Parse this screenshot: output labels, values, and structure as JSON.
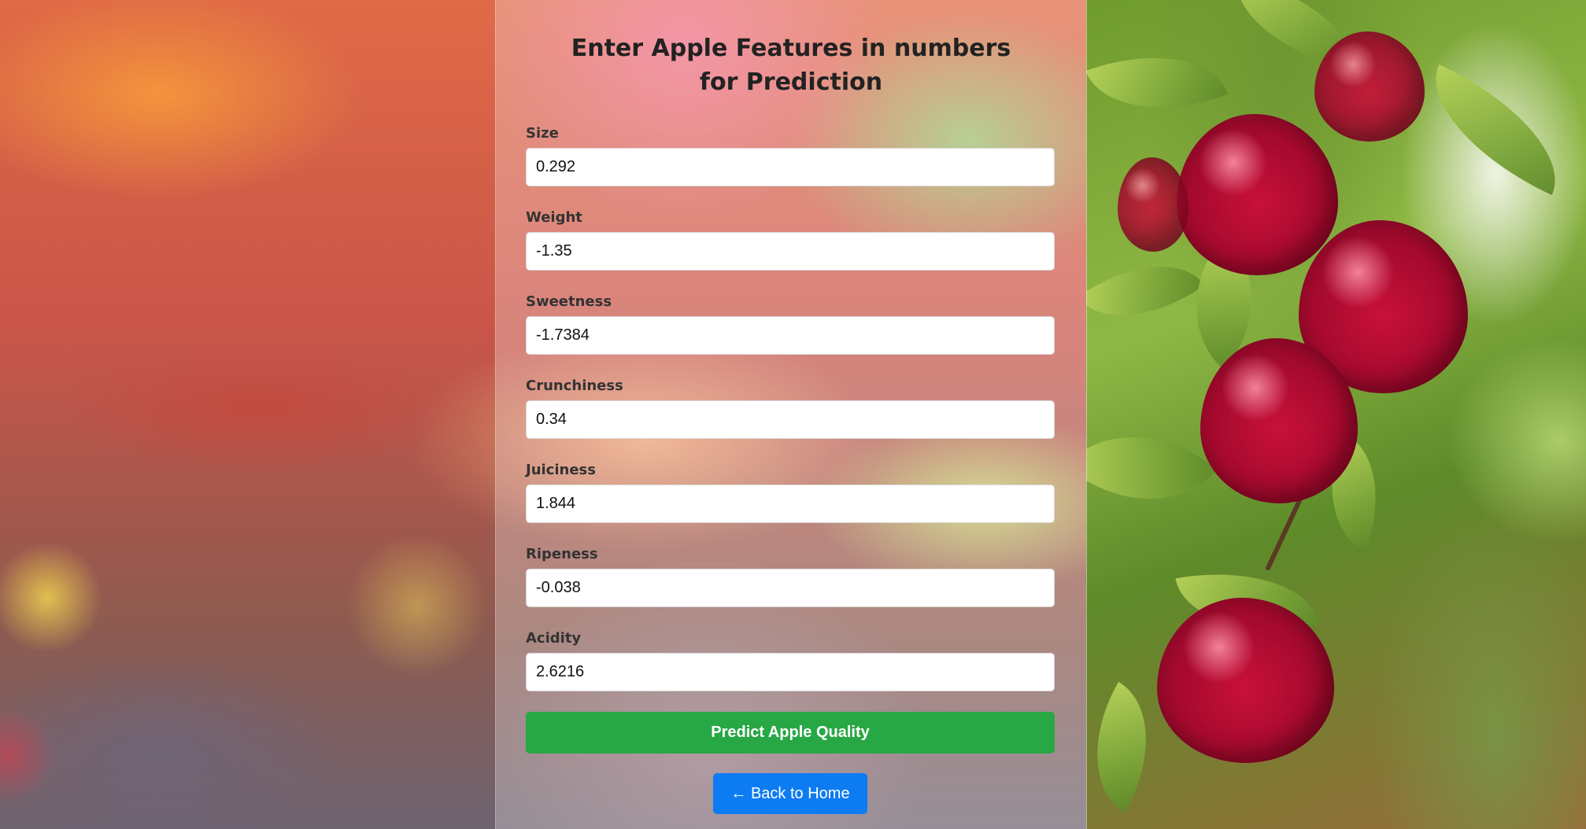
{
  "page": {
    "title": "Enter Apple Features in numbers for Prediction"
  },
  "form": {
    "fields": [
      {
        "label": "Size",
        "value": "0.292"
      },
      {
        "label": "Weight",
        "value": "-1.35"
      },
      {
        "label": "Sweetness",
        "value": "-1.7384"
      },
      {
        "label": "Crunchiness",
        "value": "0.34"
      },
      {
        "label": "Juiciness",
        "value": "1.844"
      },
      {
        "label": "Ripeness",
        "value": "-0.038"
      },
      {
        "label": "Acidity",
        "value": "2.6216"
      }
    ],
    "predict_label": "Predict Apple Quality"
  },
  "nav": {
    "back_label": "← Back to Home"
  },
  "colors": {
    "predict_button": "#28a745",
    "back_button": "#0d7bf2"
  }
}
